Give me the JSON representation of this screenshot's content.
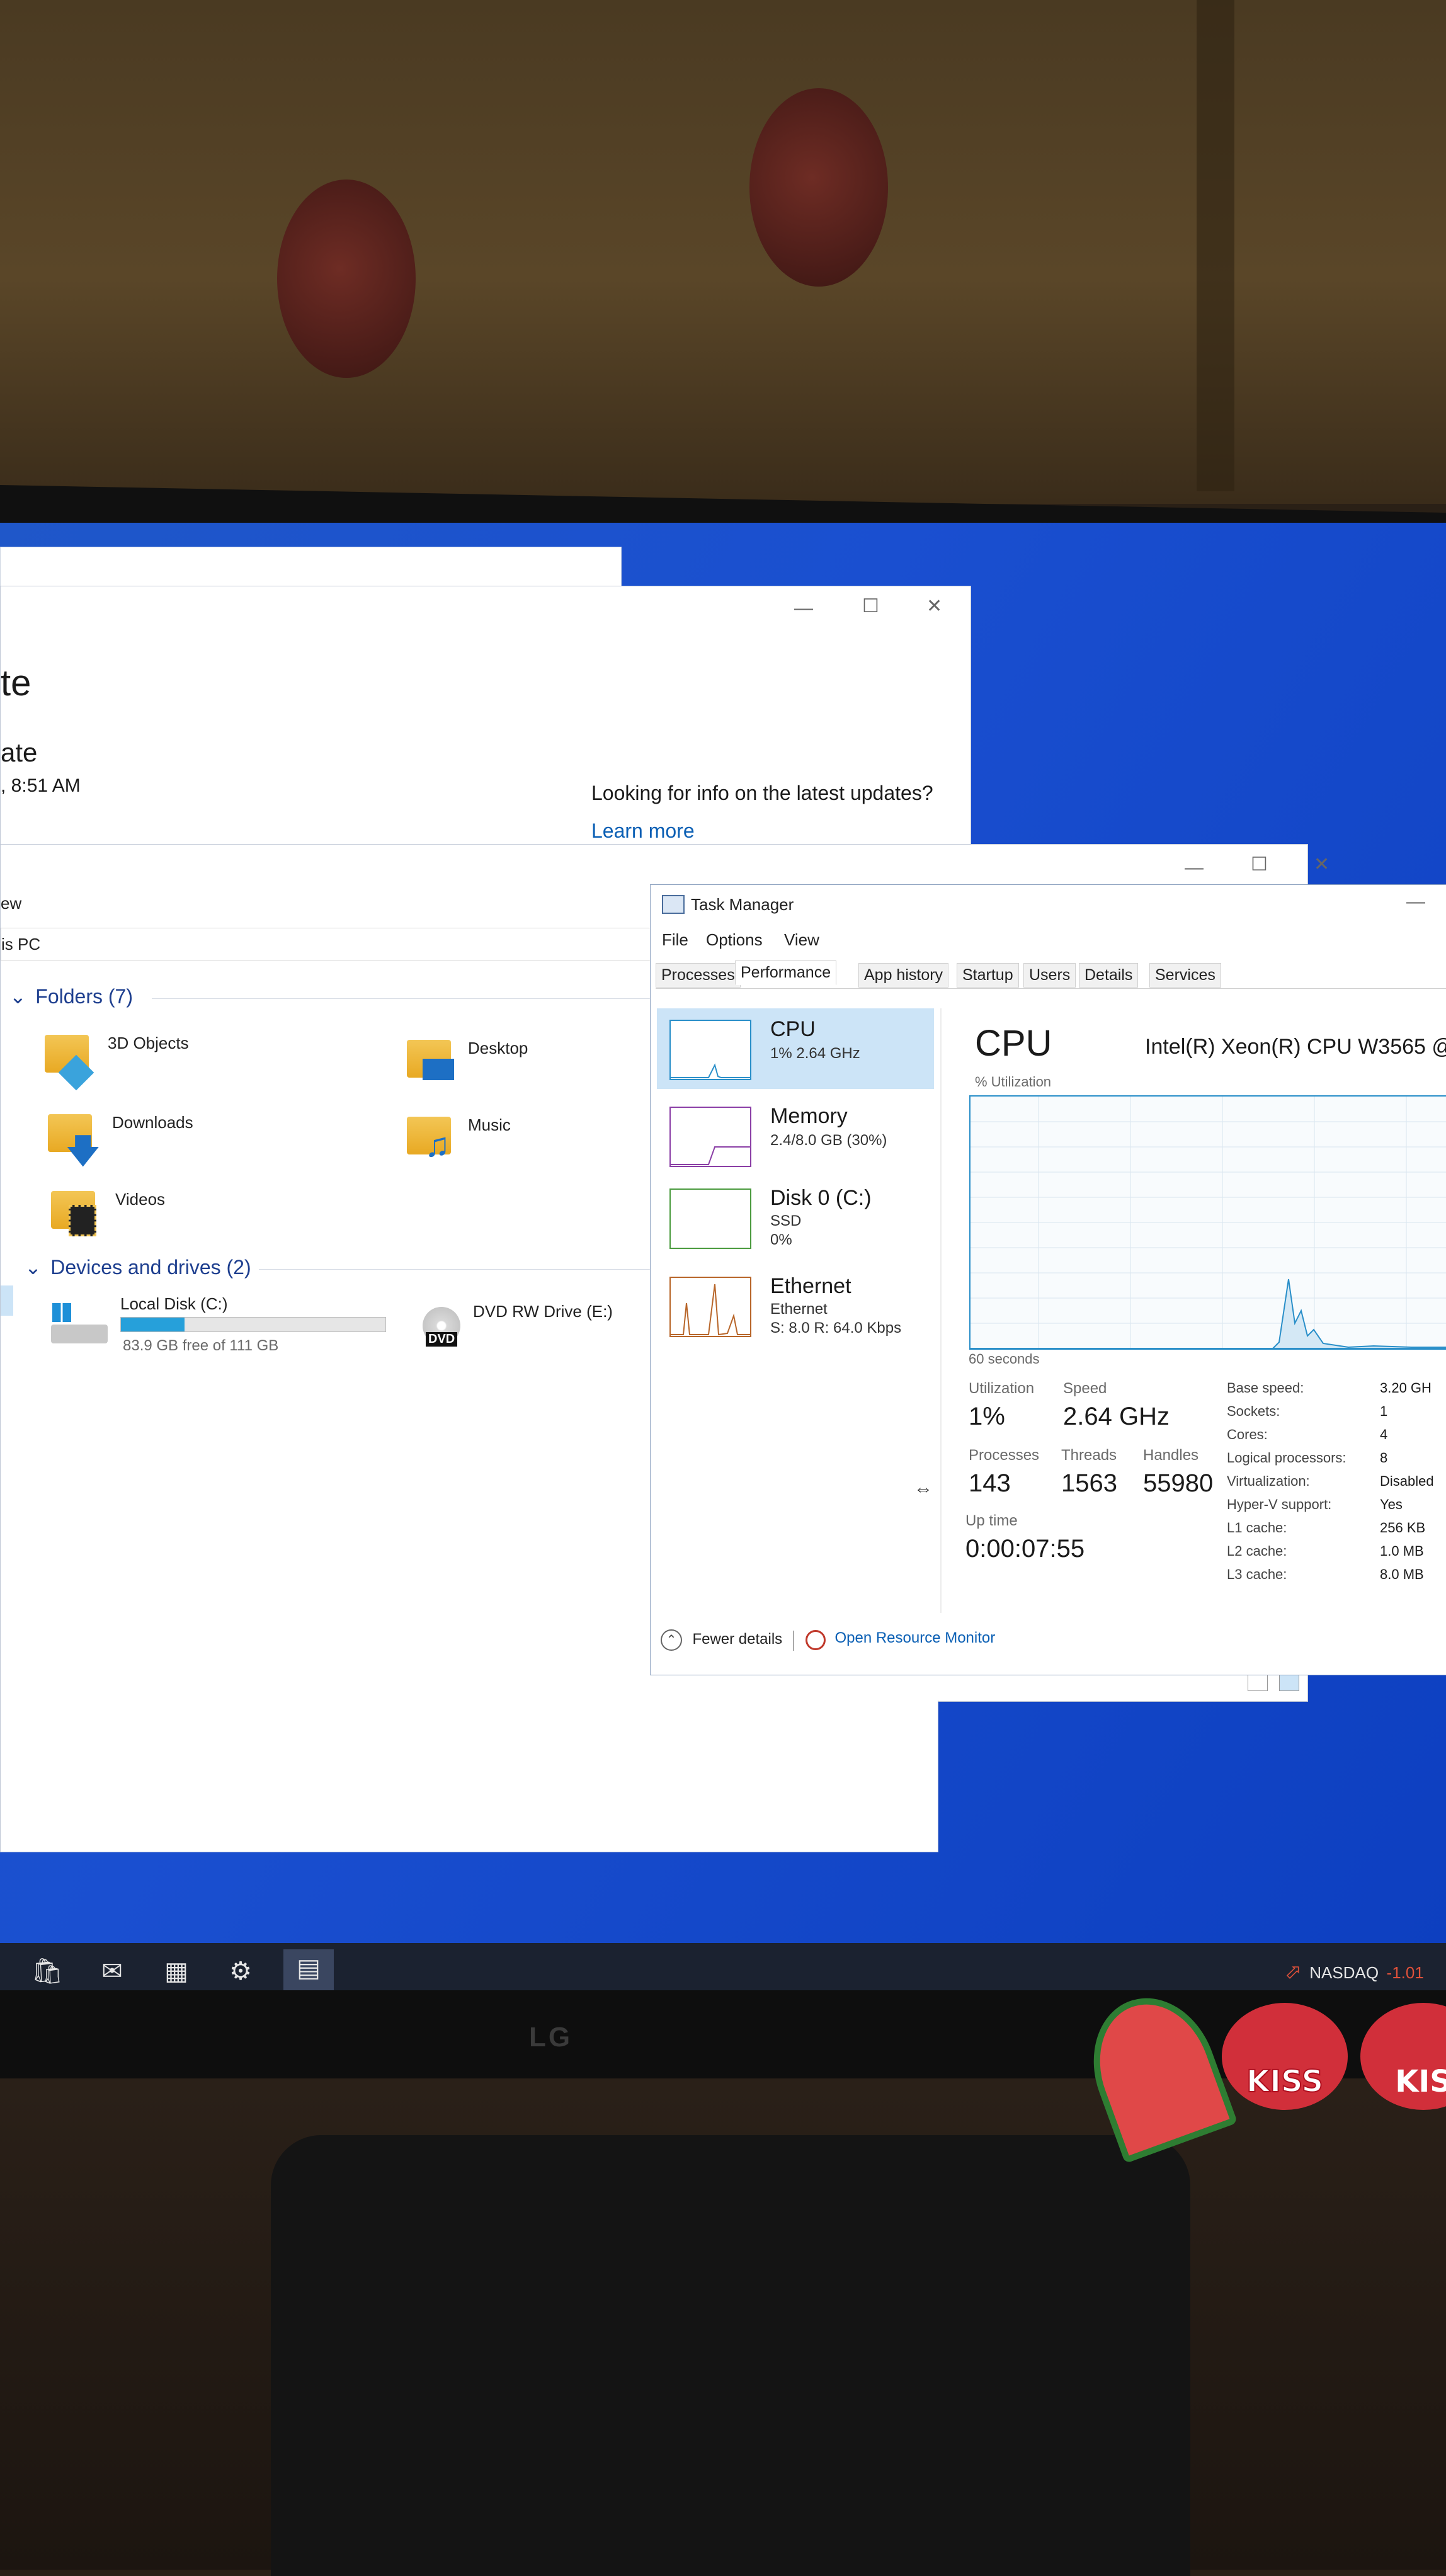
{
  "windows_update": {
    "title_fragment": "te",
    "status_fragment": "ate",
    "time_fragment": ", 8:51 AM",
    "info_text": "Looking for info on the latest updates?",
    "learn_more": "Learn more"
  },
  "explorer": {
    "menu_fragment": "ew",
    "address_fragment": "is PC",
    "folders_header": "Folders (7)",
    "folders": [
      "3D Objects",
      "Desktop",
      "Downloads",
      "Music",
      "Videos"
    ],
    "devices_header": "Devices and drives (2)",
    "drives": [
      {
        "name": "Local Disk (C:)",
        "free": "83.9 GB free of 111 GB",
        "used_fraction": 0.24
      },
      {
        "name": "DVD RW Drive (E:)",
        "badge": "DVD"
      }
    ]
  },
  "task_manager": {
    "title": "Task Manager",
    "menu": [
      "File",
      "Options",
      "View"
    ],
    "tabs": [
      "Processes",
      "Performance",
      "App history",
      "Startup",
      "Users",
      "Details",
      "Services"
    ],
    "active_tab": "Performance",
    "sidebar": [
      {
        "title": "CPU",
        "sub1": "1% 2.64 GHz"
      },
      {
        "title": "Memory",
        "sub1": "2.4/8.0 GB (30%)"
      },
      {
        "title": "Disk 0 (C:)",
        "sub1": "SSD",
        "sub2": "0%"
      },
      {
        "title": "Ethernet",
        "sub1": "Ethernet",
        "sub2": "S: 8.0 R: 64.0 Kbps"
      }
    ],
    "header": "CPU",
    "cpu_name": "Intel(R) Xeon(R) CPU W3565 @",
    "utilization_label": "% Utilization",
    "time_label": "60 seconds",
    "stats": {
      "utilization_label": "Utilization",
      "utilization_value": "1%",
      "speed_label": "Speed",
      "speed_value": "2.64 GHz",
      "processes_label": "Processes",
      "processes_value": "143",
      "threads_label": "Threads",
      "threads_value": "1563",
      "handles_label": "Handles",
      "handles_value": "55980",
      "uptime_label": "Up time",
      "uptime_value": "0:00:07:55"
    },
    "specs": [
      {
        "k": "Base speed:",
        "v": "3.20 GH"
      },
      {
        "k": "Sockets:",
        "v": "1"
      },
      {
        "k": "Cores:",
        "v": "4"
      },
      {
        "k": "Logical processors:",
        "v": "8"
      },
      {
        "k": "Virtualization:",
        "v": "Disabled"
      },
      {
        "k": "Hyper-V support:",
        "v": "Yes"
      },
      {
        "k": "L1 cache:",
        "v": "256 KB"
      },
      {
        "k": "L2 cache:",
        "v": "1.0 MB"
      },
      {
        "k": "L3 cache:",
        "v": "8.0 MB"
      }
    ],
    "fewer_details": "Fewer details",
    "resource_monitor": "Open Resource Monitor"
  },
  "taskbar": {
    "stock_name": "NASDAQ",
    "stock_change": "-1.01"
  },
  "bezel_logo": "LG",
  "stickers": [
    "KISS",
    "KIS"
  ],
  "colors": {
    "desktop_blue": "#1a4fd0",
    "accent": "#26a0da",
    "link": "#0a5fb4",
    "cpu_graph": "#2a8fc9",
    "memory_graph": "#8b3fa6",
    "disk_graph": "#4b9b3f",
    "ethernet_graph": "#b8662a",
    "stock_negative": "#e0513a"
  }
}
